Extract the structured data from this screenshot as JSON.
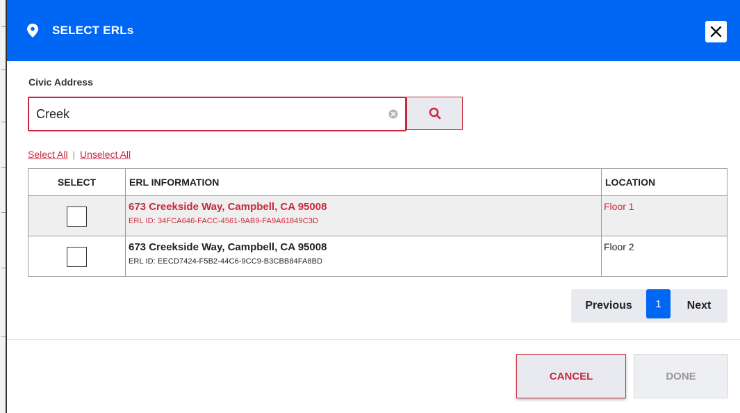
{
  "dialog": {
    "title": "SELECT ERLs",
    "colors": {
      "header": "#0067f4",
      "accent": "#c8283c"
    }
  },
  "search": {
    "label": "Civic Address",
    "value": "Creek"
  },
  "links": {
    "select_all": "Select All",
    "separator": "|",
    "unselect_all": "Unselect All"
  },
  "table": {
    "headers": [
      "SELECT",
      "ERL INFORMATION",
      "LOCATION"
    ],
    "rows": [
      {
        "address": "673 Creekside Way, Campbell, CA 95008",
        "erl_id": "ERL ID: 34FCA646-FACC-4561-9AB9-FA9A61849C3D",
        "location": "Floor 1",
        "checked": false
      },
      {
        "address": "673 Creekside Way, Campbell, CA 95008",
        "erl_id": "ERL ID: EECD7424-F5B2-44C6-9CC9-B3CBB84FA8BD",
        "location": "Floor 2",
        "checked": false
      }
    ]
  },
  "pagination": {
    "previous": "Previous",
    "current": "1",
    "next": "Next"
  },
  "footer": {
    "cancel": "CANCEL",
    "done": "DONE"
  }
}
